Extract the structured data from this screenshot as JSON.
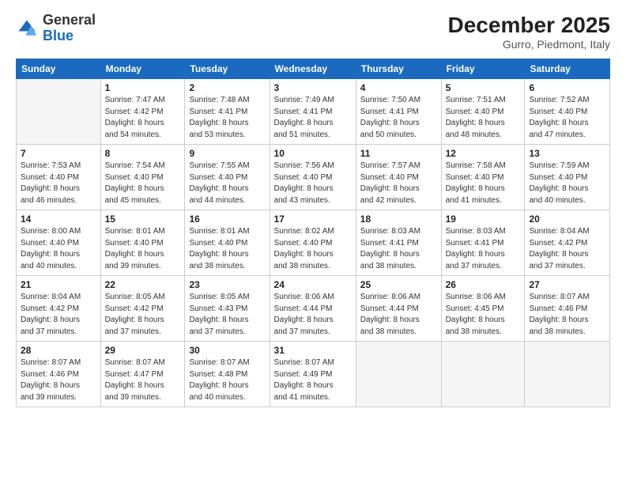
{
  "logo": {
    "general": "General",
    "blue": "Blue"
  },
  "header": {
    "month": "December 2025",
    "location": "Gurro, Piedmont, Italy"
  },
  "weekdays": [
    "Sunday",
    "Monday",
    "Tuesday",
    "Wednesday",
    "Thursday",
    "Friday",
    "Saturday"
  ],
  "weeks": [
    [
      {
        "day": "",
        "info": ""
      },
      {
        "day": "1",
        "info": "Sunrise: 7:47 AM\nSunset: 4:42 PM\nDaylight: 8 hours\nand 54 minutes."
      },
      {
        "day": "2",
        "info": "Sunrise: 7:48 AM\nSunset: 4:41 PM\nDaylight: 8 hours\nand 53 minutes."
      },
      {
        "day": "3",
        "info": "Sunrise: 7:49 AM\nSunset: 4:41 PM\nDaylight: 8 hours\nand 51 minutes."
      },
      {
        "day": "4",
        "info": "Sunrise: 7:50 AM\nSunset: 4:41 PM\nDaylight: 8 hours\nand 50 minutes."
      },
      {
        "day": "5",
        "info": "Sunrise: 7:51 AM\nSunset: 4:40 PM\nDaylight: 8 hours\nand 48 minutes."
      },
      {
        "day": "6",
        "info": "Sunrise: 7:52 AM\nSunset: 4:40 PM\nDaylight: 8 hours\nand 47 minutes."
      }
    ],
    [
      {
        "day": "7",
        "info": "Sunrise: 7:53 AM\nSunset: 4:40 PM\nDaylight: 8 hours\nand 46 minutes."
      },
      {
        "day": "8",
        "info": "Sunrise: 7:54 AM\nSunset: 4:40 PM\nDaylight: 8 hours\nand 45 minutes."
      },
      {
        "day": "9",
        "info": "Sunrise: 7:55 AM\nSunset: 4:40 PM\nDaylight: 8 hours\nand 44 minutes."
      },
      {
        "day": "10",
        "info": "Sunrise: 7:56 AM\nSunset: 4:40 PM\nDaylight: 8 hours\nand 43 minutes."
      },
      {
        "day": "11",
        "info": "Sunrise: 7:57 AM\nSunset: 4:40 PM\nDaylight: 8 hours\nand 42 minutes."
      },
      {
        "day": "12",
        "info": "Sunrise: 7:58 AM\nSunset: 4:40 PM\nDaylight: 8 hours\nand 41 minutes."
      },
      {
        "day": "13",
        "info": "Sunrise: 7:59 AM\nSunset: 4:40 PM\nDaylight: 8 hours\nand 40 minutes."
      }
    ],
    [
      {
        "day": "14",
        "info": "Sunrise: 8:00 AM\nSunset: 4:40 PM\nDaylight: 8 hours\nand 40 minutes."
      },
      {
        "day": "15",
        "info": "Sunrise: 8:01 AM\nSunset: 4:40 PM\nDaylight: 8 hours\nand 39 minutes."
      },
      {
        "day": "16",
        "info": "Sunrise: 8:01 AM\nSunset: 4:40 PM\nDaylight: 8 hours\nand 38 minutes."
      },
      {
        "day": "17",
        "info": "Sunrise: 8:02 AM\nSunset: 4:40 PM\nDaylight: 8 hours\nand 38 minutes."
      },
      {
        "day": "18",
        "info": "Sunrise: 8:03 AM\nSunset: 4:41 PM\nDaylight: 8 hours\nand 38 minutes."
      },
      {
        "day": "19",
        "info": "Sunrise: 8:03 AM\nSunset: 4:41 PM\nDaylight: 8 hours\nand 37 minutes."
      },
      {
        "day": "20",
        "info": "Sunrise: 8:04 AM\nSunset: 4:42 PM\nDaylight: 8 hours\nand 37 minutes."
      }
    ],
    [
      {
        "day": "21",
        "info": "Sunrise: 8:04 AM\nSunset: 4:42 PM\nDaylight: 8 hours\nand 37 minutes."
      },
      {
        "day": "22",
        "info": "Sunrise: 8:05 AM\nSunset: 4:42 PM\nDaylight: 8 hours\nand 37 minutes."
      },
      {
        "day": "23",
        "info": "Sunrise: 8:05 AM\nSunset: 4:43 PM\nDaylight: 8 hours\nand 37 minutes."
      },
      {
        "day": "24",
        "info": "Sunrise: 8:06 AM\nSunset: 4:44 PM\nDaylight: 8 hours\nand 37 minutes."
      },
      {
        "day": "25",
        "info": "Sunrise: 8:06 AM\nSunset: 4:44 PM\nDaylight: 8 hours\nand 38 minutes."
      },
      {
        "day": "26",
        "info": "Sunrise: 8:06 AM\nSunset: 4:45 PM\nDaylight: 8 hours\nand 38 minutes."
      },
      {
        "day": "27",
        "info": "Sunrise: 8:07 AM\nSunset: 4:46 PM\nDaylight: 8 hours\nand 38 minutes."
      }
    ],
    [
      {
        "day": "28",
        "info": "Sunrise: 8:07 AM\nSunset: 4:46 PM\nDaylight: 8 hours\nand 39 minutes."
      },
      {
        "day": "29",
        "info": "Sunrise: 8:07 AM\nSunset: 4:47 PM\nDaylight: 8 hours\nand 39 minutes."
      },
      {
        "day": "30",
        "info": "Sunrise: 8:07 AM\nSunset: 4:48 PM\nDaylight: 8 hours\nand 40 minutes."
      },
      {
        "day": "31",
        "info": "Sunrise: 8:07 AM\nSunset: 4:49 PM\nDaylight: 8 hours\nand 41 minutes."
      },
      {
        "day": "",
        "info": ""
      },
      {
        "day": "",
        "info": ""
      },
      {
        "day": "",
        "info": ""
      }
    ]
  ]
}
